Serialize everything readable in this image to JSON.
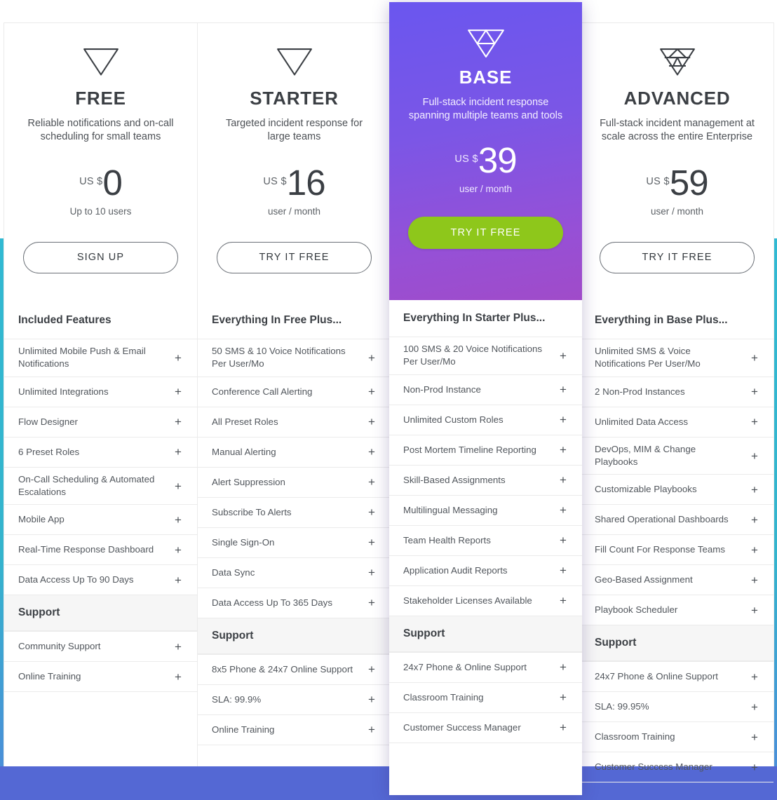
{
  "theme": {
    "accent_teal": "#31b9d2",
    "accent_blue": "#5468d4",
    "featured_gradient_start": "#6a56ef",
    "featured_gradient_end": "#a04bc9",
    "cta_green": "#8ec71b",
    "text_dark": "#3b3f44",
    "text_body": "#51565c"
  },
  "plans": [
    {
      "id": "free",
      "icon": "triangle-1-icon",
      "name": "FREE",
      "description": "Reliable notifications and on-call scheduling for small teams",
      "currency": "US $",
      "amount": "0",
      "price_note": "Up to 10 users",
      "cta_label": "SIGN UP",
      "sections": [
        {
          "title": "Included Features",
          "type": "features",
          "items": [
            "Unlimited Mobile Push & Email Notifications",
            "Unlimited Integrations",
            "Flow Designer",
            "6 Preset Roles",
            "On-Call Scheduling & Automated Escalations",
            "Mobile App",
            "Real-Time Response Dashboard",
            "Data Access Up To 90 Days"
          ]
        },
        {
          "title": "Support",
          "type": "support",
          "items": [
            "Community Support",
            "Online Training"
          ]
        }
      ]
    },
    {
      "id": "starter",
      "icon": "triangle-2-icon",
      "name": "STARTER",
      "description": "Targeted incident response for large teams",
      "currency": "US $",
      "amount": "16",
      "price_note": "user / month",
      "cta_label": "TRY IT FREE",
      "sections": [
        {
          "title": "Everything In Free Plus...",
          "type": "features",
          "items": [
            "50 SMS & 10 Voice Notifications Per User/Mo",
            "Conference Call Alerting",
            "All Preset Roles",
            "Manual Alerting",
            "Alert Suppression",
            "Subscribe To Alerts",
            "Single Sign-On",
            "Data Sync",
            "Data Access Up To 365 Days"
          ]
        },
        {
          "title": "Support",
          "type": "support",
          "items": [
            "8x5 Phone & 24x7 Online Support",
            "SLA: 99.9%",
            "Online Training"
          ]
        }
      ]
    },
    {
      "id": "base",
      "icon": "triangle-4-icon",
      "name": "BASE",
      "description": "Full-stack incident response spanning multiple teams and tools",
      "currency": "US $",
      "amount": "39",
      "price_note": "user / month",
      "cta_label": "TRY IT FREE",
      "featured": true,
      "sections": [
        {
          "title": "Everything In Starter Plus...",
          "type": "features",
          "items": [
            "100 SMS & 20 Voice Notifications Per User/Mo",
            "Non-Prod Instance",
            "Unlimited Custom Roles",
            "Post Mortem Timeline Reporting",
            "Skill-Based Assignments",
            "Multilingual Messaging",
            "Team Health Reports",
            "Application Audit Reports",
            "Stakeholder Licenses Available"
          ]
        },
        {
          "title": "Support",
          "type": "support",
          "items": [
            "24x7 Phone & Online Support",
            "Classroom Training",
            "Customer Success Manager"
          ]
        }
      ]
    },
    {
      "id": "advanced",
      "icon": "triangle-9-icon",
      "name": "ADVANCED",
      "description": "Full-stack incident management at scale across the entire Enterprise",
      "currency": "US $",
      "amount": "59",
      "price_note": "user / month",
      "cta_label": "TRY IT FREE",
      "sections": [
        {
          "title": "Everything in Base Plus...",
          "type": "features",
          "items": [
            "Unlimited SMS & Voice Notifications Per User/Mo",
            "2 Non-Prod Instances",
            "Unlimited Data Access",
            "DevOps, MIM & Change Playbooks",
            "Customizable Playbooks",
            "Shared Operational Dashboards",
            "Fill Count For Response Teams",
            "Geo-Based Assignment",
            "Playbook Scheduler"
          ]
        },
        {
          "title": "Support",
          "type": "support",
          "items": [
            "24x7 Phone & Online Support",
            "SLA: 99.95%",
            "Classroom Training",
            "Customer Success Manager"
          ]
        }
      ]
    }
  ],
  "expand_glyph": "+"
}
